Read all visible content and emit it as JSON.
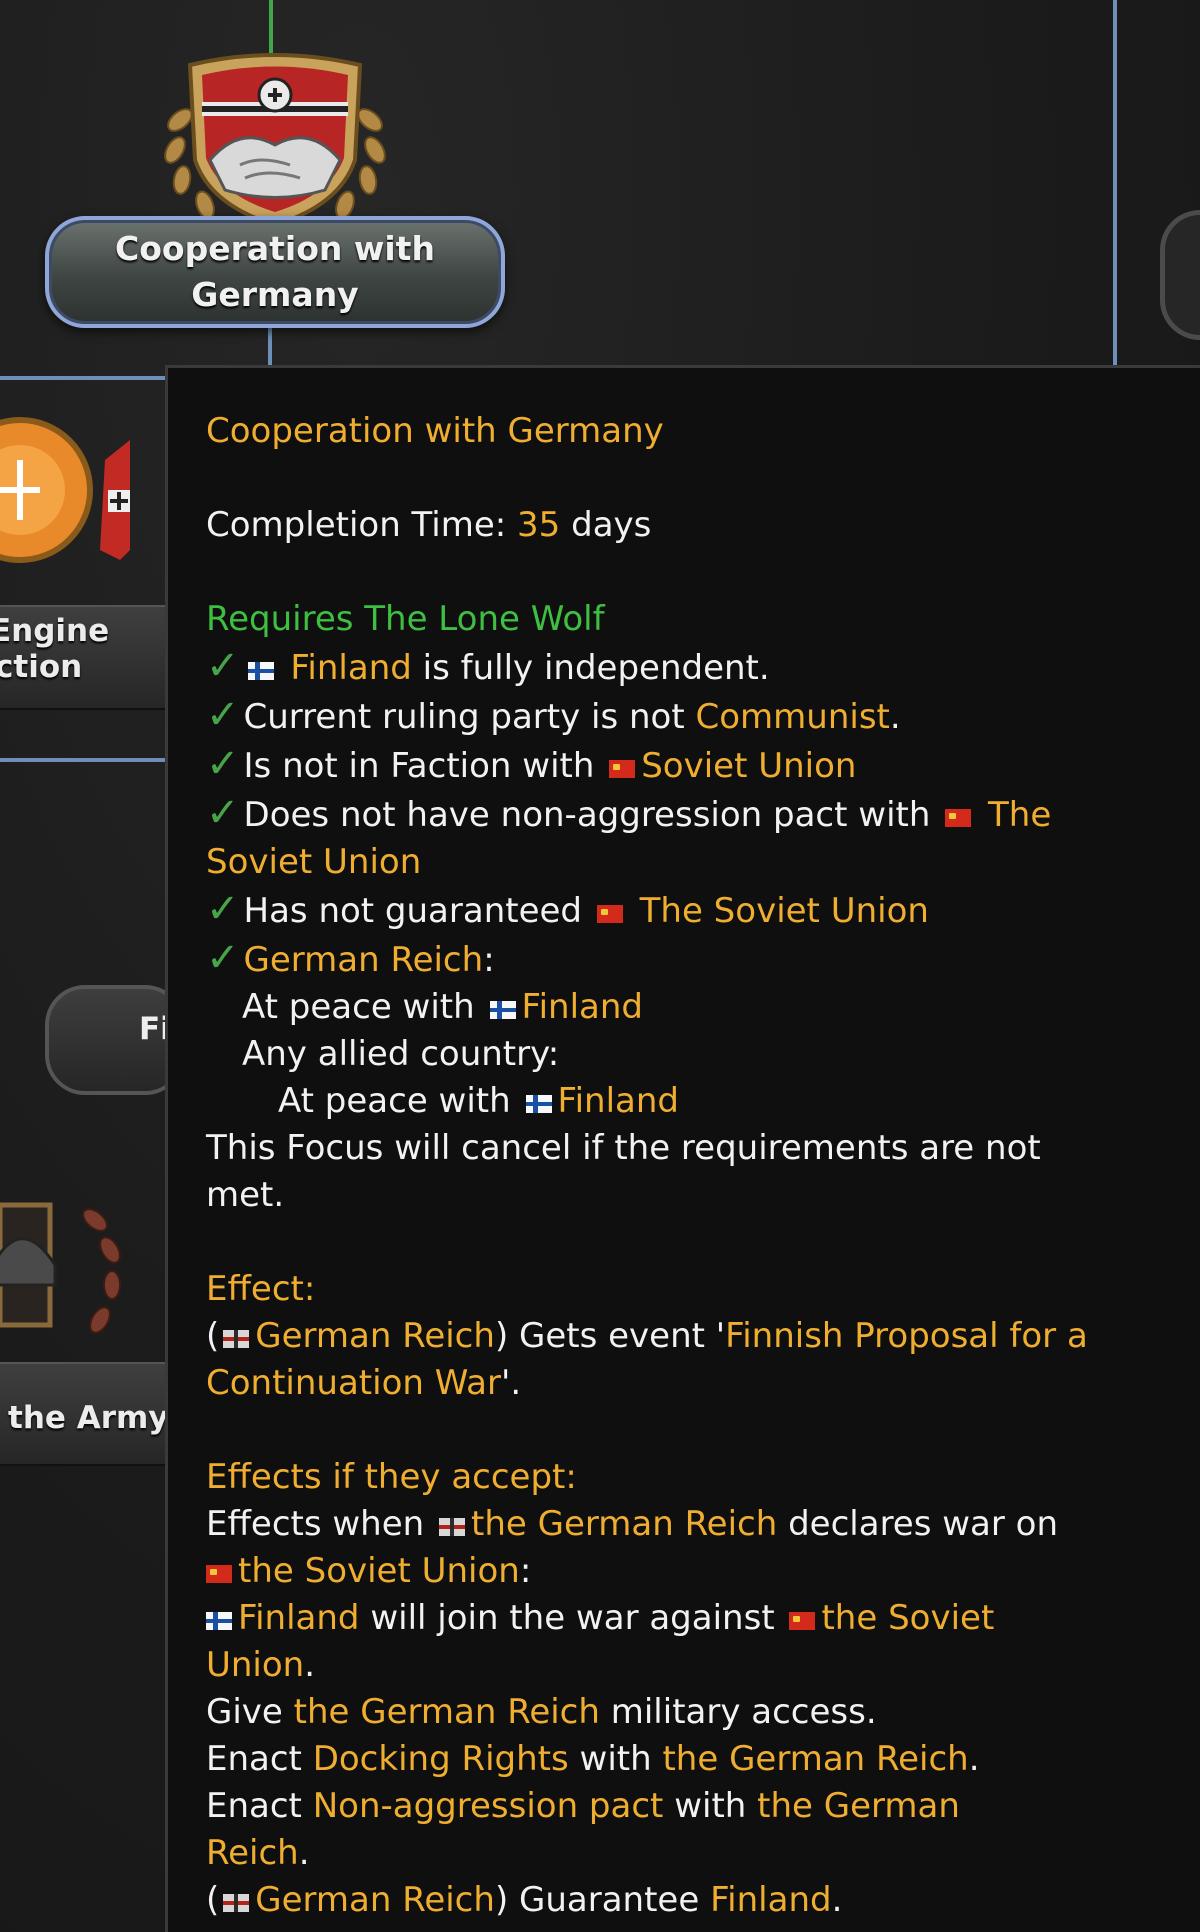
{
  "focus_tree": {
    "main_node": {
      "label": "Cooperation with Germany",
      "icon": "handshake-shield-icon"
    },
    "left_nodes": [
      {
        "label_line1": "Engine",
        "label_line2": "ction",
        "icon": "ensila-emblem-icon"
      },
      {
        "label_line1": "Fi",
        "label_line2": "",
        "icon": ""
      },
      {
        "label_line1": "the Army",
        "label_line2": "",
        "icon": "helmet-wreath-icon"
      }
    ]
  },
  "tooltip": {
    "title": "Cooperation with Germany",
    "completion_label": "Completion Time:",
    "completion_value": "35",
    "completion_unit": "days",
    "requires_label": "Requires The Lone Wolf",
    "req1_country": "Finland",
    "req1_text": "is fully independent.",
    "req2_text": "Current ruling party is not",
    "req2_value": "Communist",
    "req3_text": "Is not in Faction with",
    "req3_value": "Soviet Union",
    "req4_text": "Does not have non-aggression pact with",
    "req4_value_a": "The",
    "req4_value_b": "Soviet Union",
    "req5_text": "Has not guaranteed",
    "req5_value": "The Soviet Union",
    "req6_value": "German Reich",
    "sub1_text": "At peace with",
    "sub1_value": "Finland",
    "sub2_text": "Any allied country:",
    "sub3_text": "At peace with",
    "sub3_value": "Finland",
    "cancel_line1": "This Focus will cancel if the requirements are not",
    "cancel_line2": "met.",
    "effect_label": "Effect:",
    "effect_country": "German Reich",
    "effect_text": ") Gets event '",
    "effect_event_a": "Finnish Proposal for a",
    "effect_event_b": "Continuation War",
    "accept_label": "Effects if they accept:",
    "acc1_text": "Effects when",
    "acc1_value": "the German Reich",
    "acc1_text2": "declares war on",
    "acc1_value2": "the Soviet Union",
    "acc2_value": "Finland",
    "acc2_text": "will join the war against",
    "acc2_value2a": "the Soviet",
    "acc2_value2b": "Union",
    "acc3_text": "Give",
    "acc3_value": "the German Reich",
    "acc3_text2": "military access.",
    "acc4_text": "Enact",
    "acc4_value": "Docking Rights",
    "acc4_text2": "with",
    "acc4_value2": "the German Reich",
    "acc5_text": "Enact",
    "acc5_value": "Non-aggression pact",
    "acc5_text2": "with",
    "acc5_value2a": "the German",
    "acc5_value2b": "Reich",
    "acc6_value": "German Reich",
    "acc6_text": ") Guarantee",
    "acc6_value2": "Finland"
  },
  "colors": {
    "highlight": "#f0ae31",
    "requirement": "#3fbf42",
    "check": "#46a548"
  }
}
